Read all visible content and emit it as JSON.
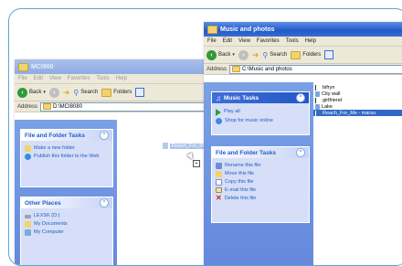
{
  "back_window": {
    "title": "MCI900",
    "menu": [
      "File",
      "Edit",
      "View",
      "Favorites",
      "Tools",
      "Help"
    ],
    "toolbar": {
      "back": "Back",
      "search": "Search",
      "folders": "Folders"
    },
    "address_label": "Address",
    "address_value": "D:\\MCI8080",
    "panels": {
      "file_tasks": {
        "title": "File and Folder Tasks",
        "items": [
          "Make a new folder",
          "Publish this folder to the Web"
        ]
      },
      "other_places": {
        "title": "Other Places",
        "items": [
          "LEXSK (D:)",
          "My Documents",
          "My Computer"
        ]
      }
    }
  },
  "drag_ghost": "Reach_For_Me - marsu",
  "front_window": {
    "title": "Music and photos",
    "menu": [
      "File",
      "Edit",
      "View",
      "Favorites",
      "Tools",
      "Help"
    ],
    "toolbar": {
      "back": "Back",
      "search": "Search",
      "folders": "Folders"
    },
    "address_label": "Address",
    "address_value": "C:\\Music and photos",
    "panels": {
      "music_tasks": {
        "title": "Music Tasks",
        "items": [
          "Play all",
          "Shop for music online"
        ]
      },
      "file_tasks": {
        "title": "File and Folder Tasks",
        "items": [
          "Rename this file",
          "Move this file",
          "Copy this file",
          "E-mail this file",
          "Delete this file"
        ]
      }
    },
    "files": [
      "bifryn",
      "City wall",
      "girlfriend",
      "Lake",
      "Reach_For_Me - marsu"
    ],
    "selected_file": "Reach_For_Me - marsu"
  }
}
